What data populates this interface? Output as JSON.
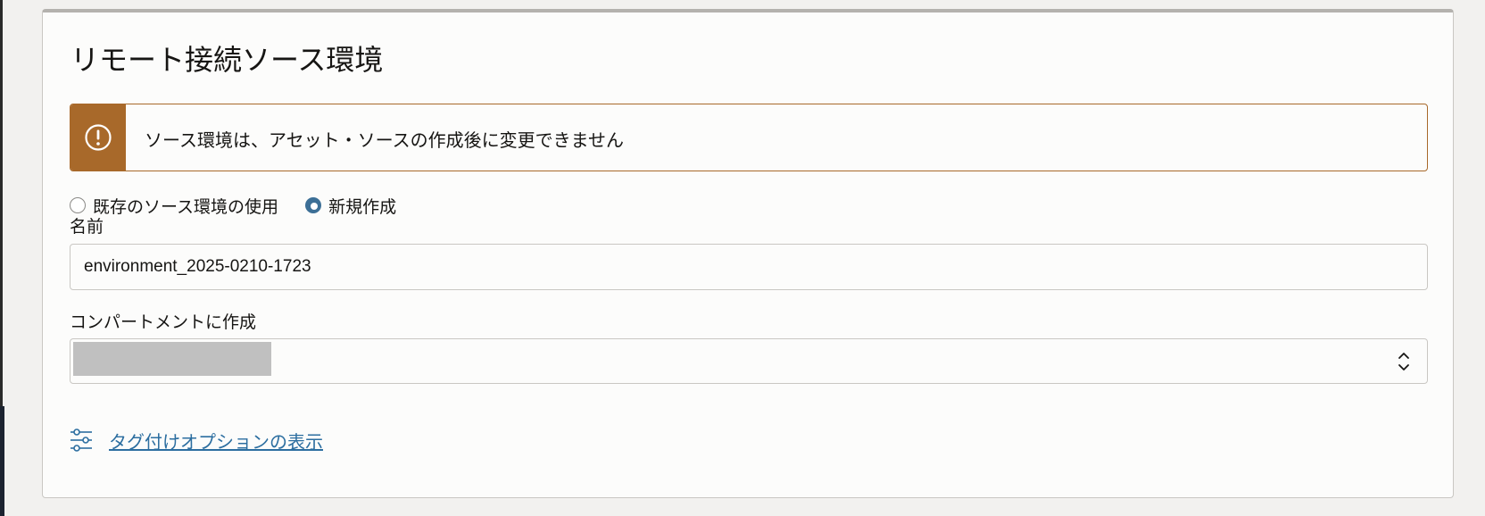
{
  "panel": {
    "title": "リモート接続ソース環境"
  },
  "warning": {
    "icon": "exclamation-circle-icon",
    "message": "ソース環境は、アセット・ソースの作成後に変更できません",
    "color": "#a8692a"
  },
  "environment_choice": {
    "options": [
      {
        "label": "既存のソース環境の使用",
        "checked": false
      },
      {
        "label": "新規作成",
        "checked": true
      }
    ],
    "accent_color": "#3c6f96"
  },
  "name_field": {
    "label": "名前",
    "value": "environment_2025-0210-1723"
  },
  "compartment_field": {
    "label": "コンパートメントに作成",
    "icon": "chevron-up-down-icon"
  },
  "tagging": {
    "icon": "sliders-icon",
    "link_label": "タグ付けオプションの表示",
    "link_color": "#2c6ea0"
  }
}
